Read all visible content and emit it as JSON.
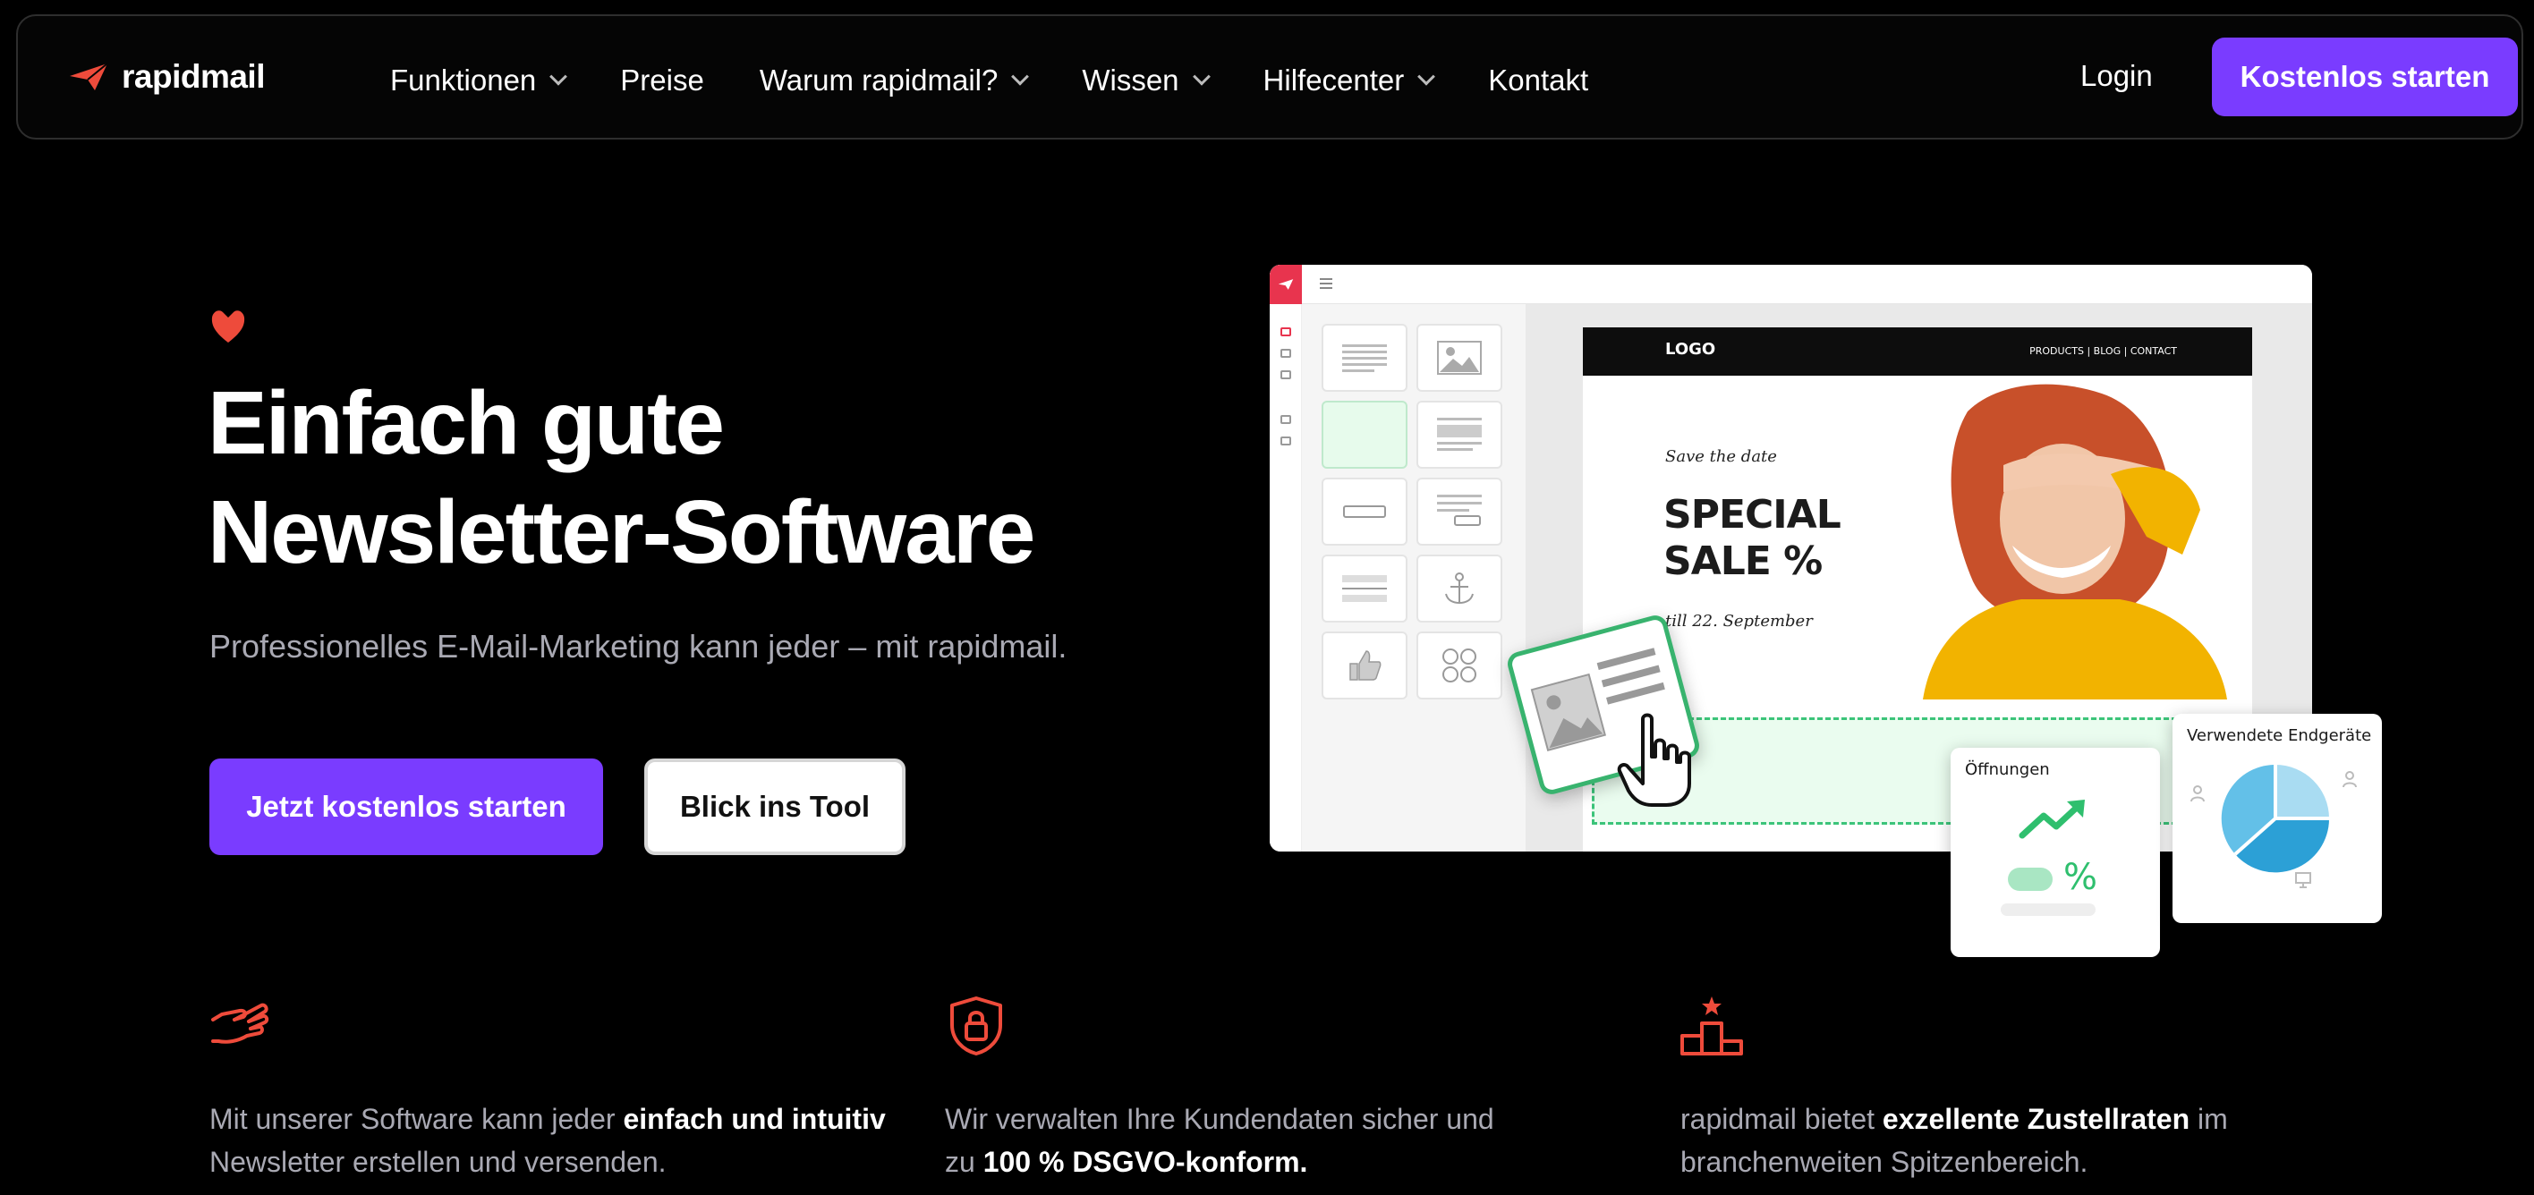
{
  "brand": {
    "name": "rapidmail",
    "accent": "#7a3cff",
    "red": "#ee4b3b"
  },
  "nav": {
    "items": [
      {
        "label": "Funktionen",
        "dropdown": true
      },
      {
        "label": "Preise",
        "dropdown": false
      },
      {
        "label": "Warum rapidmail?",
        "dropdown": true
      },
      {
        "label": "Wissen",
        "dropdown": true
      },
      {
        "label": "Hilfecenter",
        "dropdown": true
      },
      {
        "label": "Kontakt",
        "dropdown": false
      }
    ],
    "login": "Login",
    "cta": "Kostenlos starten"
  },
  "hero": {
    "title_line1": "Einfach gute",
    "title_line2": "Newsletter-Software",
    "subtitle": "Professionelles E-Mail-Marketing kann jeder – mit rapidmail.",
    "primary_button": "Jetzt kostenlos starten",
    "secondary_button": "Blick ins Tool"
  },
  "mockup": {
    "email_logo": "LOGO",
    "email_nav": "PRODUCTS |  BLOG  |  CONTACT",
    "save_the_date": "Save the date",
    "special_line1": "SPECIAL",
    "special_line2": "SALE %",
    "till": "till 22. September",
    "card_openings": "Öffnungen",
    "card_openings_symbol": "%",
    "card_devices": "Verwendete Endgeräte"
  },
  "features": [
    {
      "icon": "hand-pointing-icon",
      "pre": "Mit unserer Software kann jeder ",
      "bold": "einfach und intuitiv",
      "post": " Newsletter erstellen und versenden."
    },
    {
      "icon": "shield-lock-icon",
      "pre": "Wir verwalten Ihre Kundendaten sicher und zu ",
      "bold": "100 % DSGVO-konform.",
      "post": ""
    },
    {
      "icon": "podium-icon",
      "pre": "rapidmail bietet ",
      "bold": "exzellente Zustellraten",
      "post": " im branchenweiten Spitzenbereich."
    }
  ]
}
